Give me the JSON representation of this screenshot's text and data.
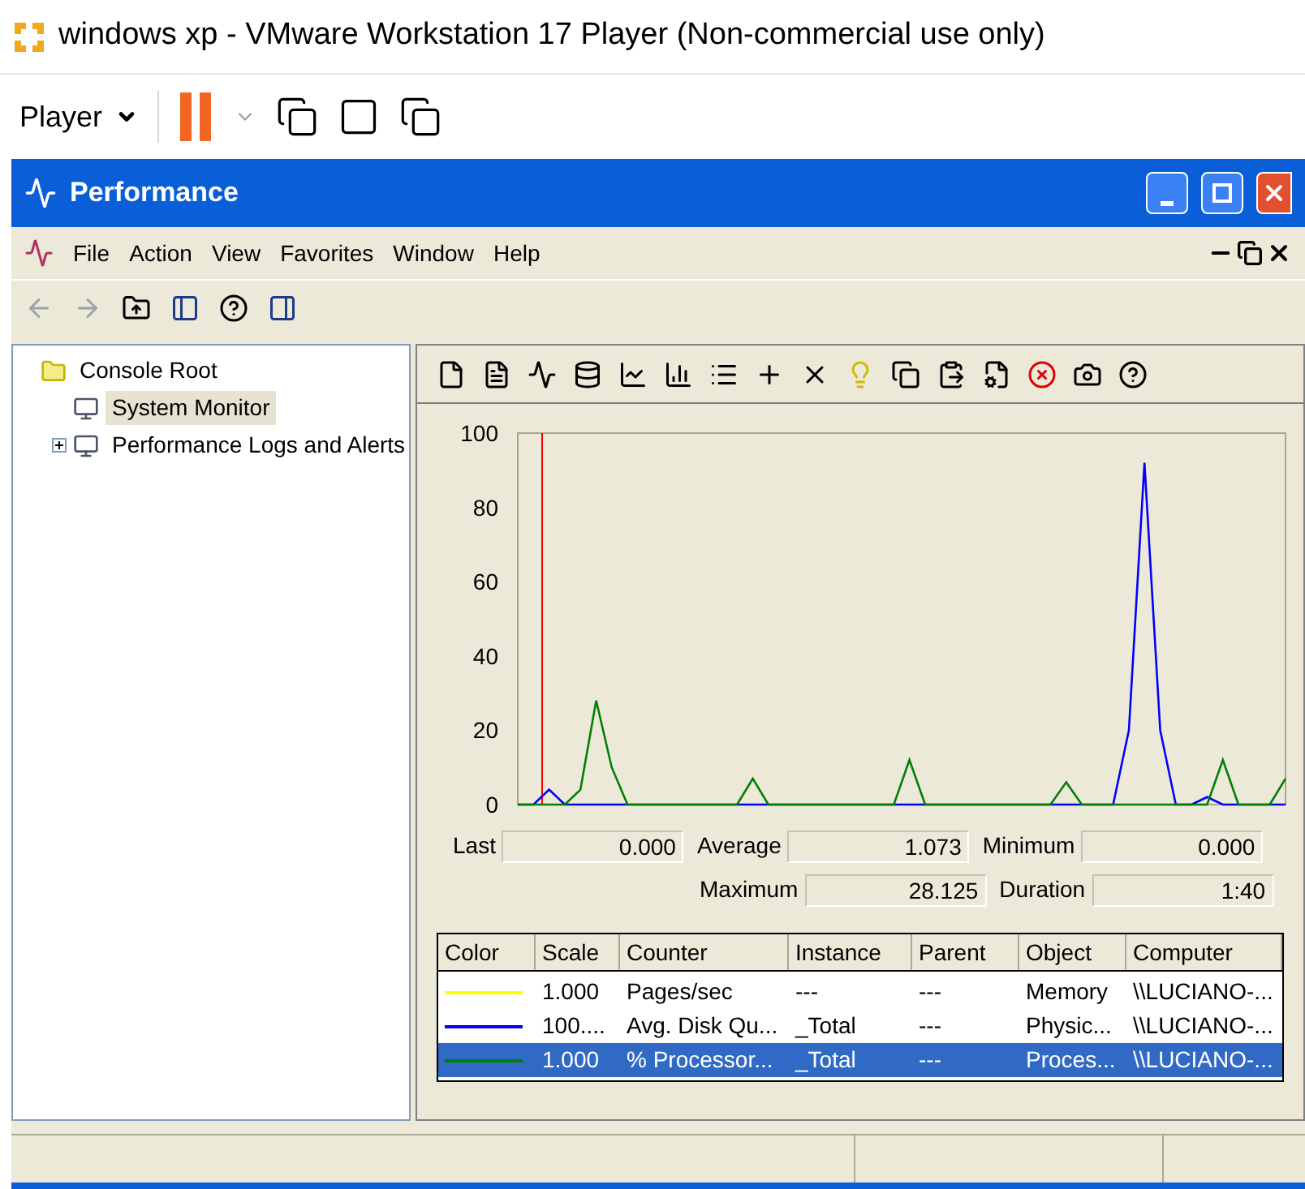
{
  "host": {
    "title": "windows xp - VMware Workstation 17 Player (Non-commercial use only)",
    "menu_label": "Player"
  },
  "window": {
    "title": "Performance"
  },
  "menu": [
    "File",
    "Action",
    "View",
    "Favorites",
    "Window",
    "Help"
  ],
  "tree": [
    {
      "label": "Console Root",
      "selected": false,
      "children": [
        {
          "label": "System Monitor",
          "selected": true
        },
        {
          "label": "Performance Logs and Alerts",
          "selected": false,
          "expanded": false
        }
      ]
    }
  ],
  "chart_data": {
    "type": "line",
    "yticks": [
      0,
      20,
      40,
      60,
      80,
      100
    ],
    "ylim": [
      0,
      100
    ],
    "series": [
      {
        "color": "#0000ff",
        "values": [
          0,
          0,
          4,
          0,
          0,
          0,
          0,
          0,
          0,
          0,
          0,
          0,
          0,
          0,
          0,
          0,
          0,
          0,
          0,
          0,
          0,
          0,
          0,
          0,
          0,
          0,
          0,
          0,
          0,
          0,
          0,
          0,
          0,
          0,
          0,
          0,
          0,
          0,
          0,
          20,
          92,
          20,
          0,
          0,
          2,
          0,
          0,
          0,
          0,
          0
        ]
      },
      {
        "color": "#008000",
        "values": [
          0,
          0,
          0,
          0,
          4,
          28,
          10,
          0,
          0,
          0,
          0,
          0,
          0,
          0,
          0,
          7,
          0,
          0,
          0,
          0,
          0,
          0,
          0,
          0,
          0,
          12,
          0,
          0,
          0,
          0,
          0,
          0,
          0,
          0,
          0,
          6,
          0,
          0,
          0,
          0,
          0,
          0,
          0,
          0,
          0,
          12,
          0,
          0,
          0,
          7
        ]
      }
    ]
  },
  "stats": [
    {
      "label": "Last",
      "value": "0.000"
    },
    {
      "label": "Average",
      "value": "1.073"
    },
    {
      "label": "Minimum",
      "value": "0.000"
    },
    {
      "label": "Maximum",
      "value": "28.125"
    },
    {
      "label": "Duration",
      "value": "1:40"
    }
  ],
  "table": {
    "columns": [
      "Color",
      "Scale",
      "Counter",
      "Instance",
      "Parent",
      "Object",
      "Computer"
    ],
    "rows": [
      {
        "color": "#ffff00",
        "selected": false,
        "cells": [
          "",
          "1.000",
          "Pages/sec",
          "---",
          "---",
          "Memory",
          "\\\\LUCIANO-..."
        ]
      },
      {
        "color": "#0000ff",
        "selected": false,
        "cells": [
          "",
          "100....",
          "Avg. Disk Qu...",
          "_Total",
          "---",
          "Physic...",
          "\\\\LUCIANO-..."
        ]
      },
      {
        "color": "#008000",
        "selected": true,
        "cells": [
          "",
          "1.000",
          "% Processor...",
          "_Total",
          "---",
          "Proces...",
          "\\\\LUCIANO-..."
        ]
      }
    ]
  }
}
